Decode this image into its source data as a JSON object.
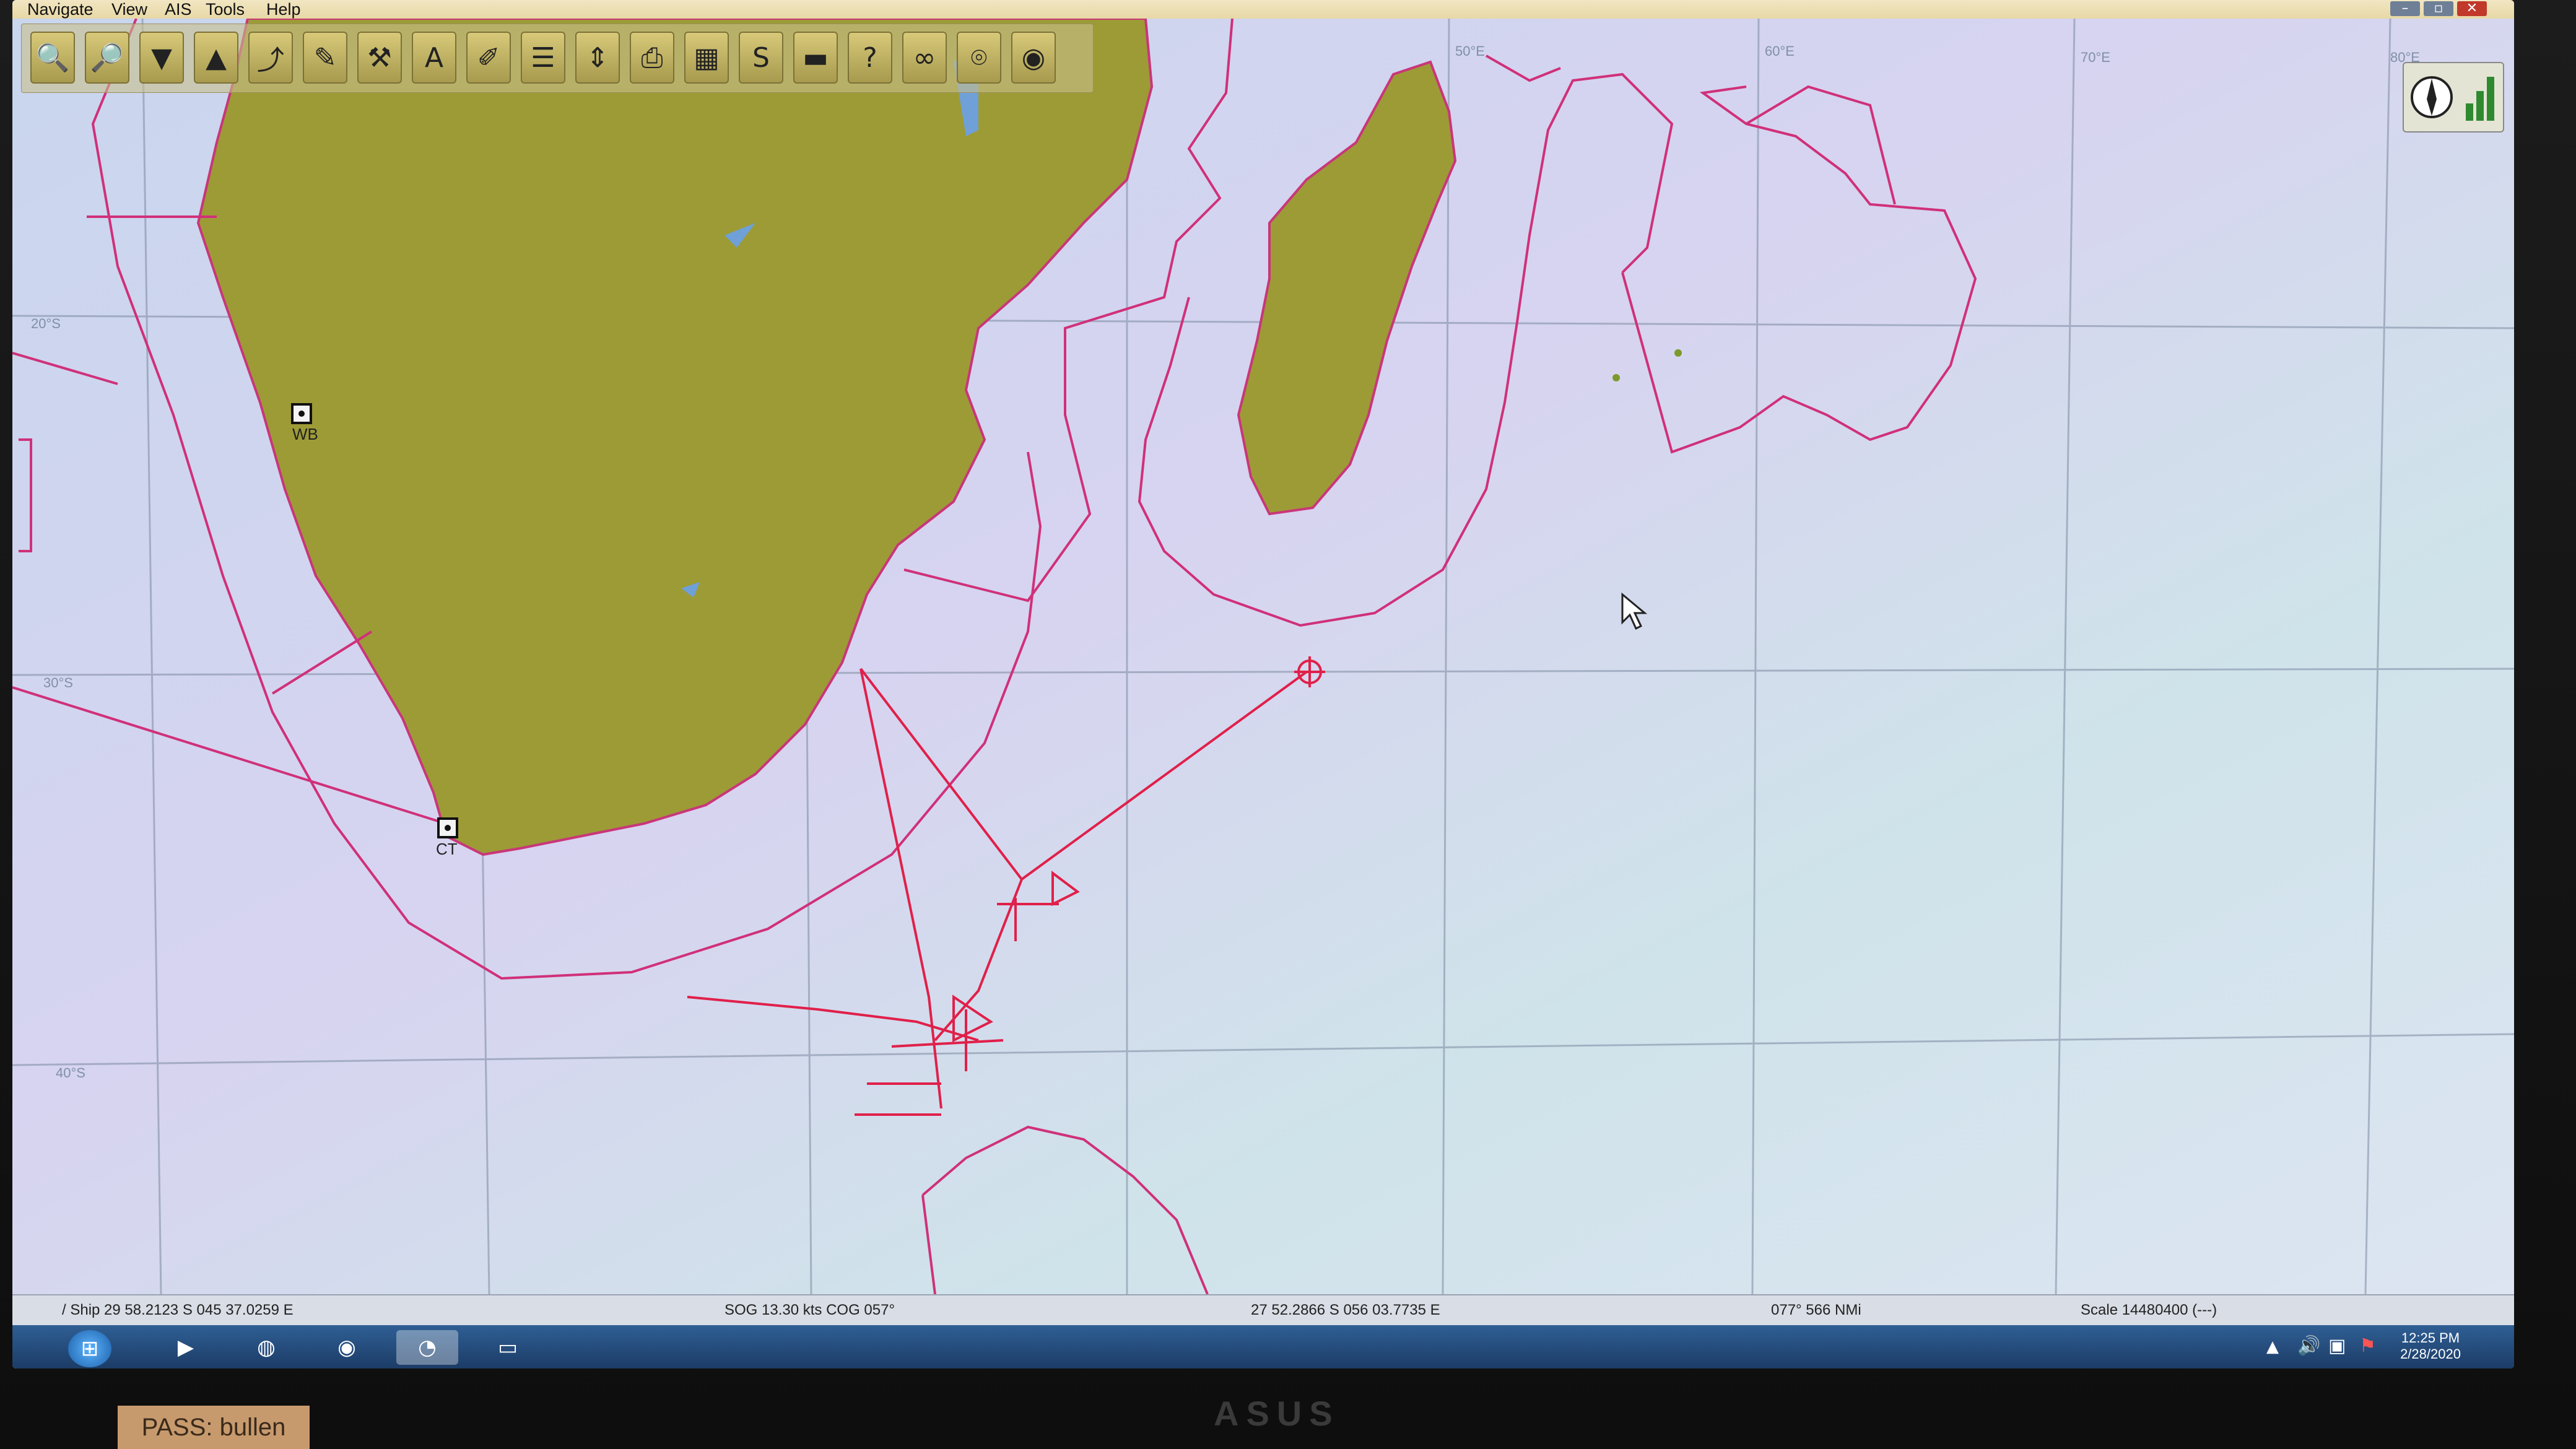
{
  "menu": [
    "Navigate",
    "View",
    "AIS",
    "Tools",
    "Help"
  ],
  "toolbar": {
    "tools": [
      {
        "name": "zoom-in-icon",
        "glyph": "🔍"
      },
      {
        "name": "zoom-out-icon",
        "glyph": "🔎"
      },
      {
        "name": "filter-icon",
        "glyph": "▼"
      },
      {
        "name": "ship-icon",
        "glyph": "▲"
      },
      {
        "name": "route-icon",
        "glyph": "⤴"
      },
      {
        "name": "pen-icon",
        "glyph": "✎"
      },
      {
        "name": "tool-icon",
        "glyph": "⚒"
      },
      {
        "name": "text-icon",
        "glyph": "A"
      },
      {
        "name": "marker-icon",
        "glyph": "✐"
      },
      {
        "name": "chart-layers-icon",
        "glyph": "☰"
      },
      {
        "name": "measure-icon",
        "glyph": "⇕"
      },
      {
        "name": "print-icon",
        "glyph": "⎙"
      },
      {
        "name": "grid-icon",
        "glyph": "▦"
      },
      {
        "name": "track-icon",
        "glyph": "S"
      },
      {
        "name": "depth-icon",
        "glyph": "▬"
      },
      {
        "name": "help-icon",
        "glyph": "?"
      },
      {
        "name": "binoculars-icon",
        "glyph": "∞"
      },
      {
        "name": "ais-icon",
        "glyph": "⌾"
      },
      {
        "name": "lifebuoy-icon",
        "glyph": "◉"
      }
    ]
  },
  "map": {
    "labels": {
      "wb": "WB",
      "ct": "CT",
      "lon50": "50°E",
      "lon60": "60°E",
      "lon70": "70°E",
      "lon80": "80°E",
      "lat20": "20°S",
      "lat30": "30°S",
      "lat40": "40°S"
    },
    "colors": {
      "land": "#9d9b36",
      "sea": "#cfd9ec",
      "boundary": "#d0307a",
      "route": "#e0204a",
      "grid": "#7c8aa0"
    }
  },
  "status": {
    "ship": "/ Ship 29 58.2123 S   045 37.0259 E",
    "sog": "SOG 13.30 kts   COG 057°",
    "cursor": "27 52.2866 S   056 03.7735 E",
    "bearing": "077°   566 NMi",
    "scale": "Scale 14480400 (---)"
  },
  "taskbar": {
    "time": "12:25 PM",
    "date": "2/28/2020"
  },
  "monitor": {
    "brand": "ASUS",
    "sticker": "PASS: bullen"
  }
}
